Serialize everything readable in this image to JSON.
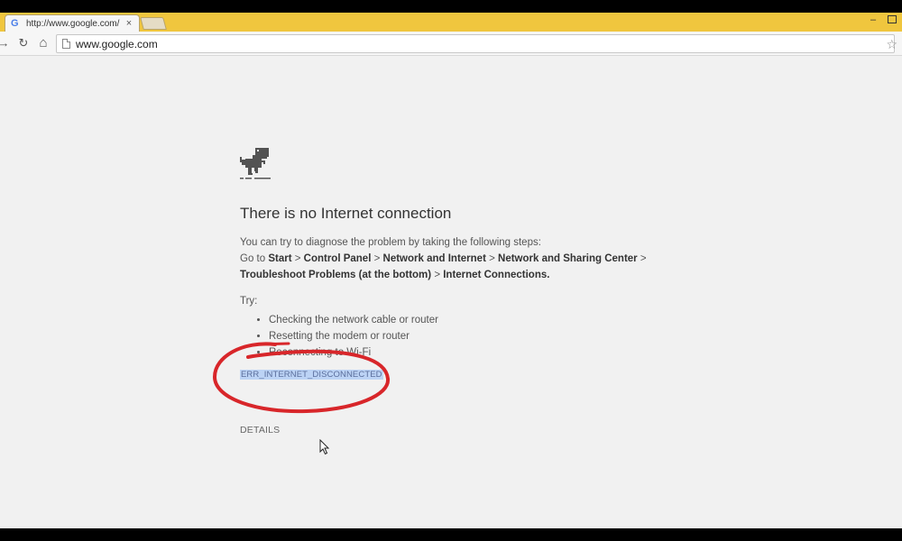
{
  "browser": {
    "tab": {
      "favicon": "G",
      "title": "http://www.google.com/",
      "close": "×"
    },
    "window_controls": {
      "minimize": "–"
    },
    "toolbar": {
      "back_icon": "→",
      "reload_icon": "↻",
      "home_icon": "⌂",
      "address": "www.google.com",
      "star_icon": "☆"
    },
    "colors": {
      "tabstrip": "#f0c63e",
      "highlight": "#bcd3f5",
      "annotation": "#d8262a"
    }
  },
  "error_page": {
    "icon": "dino-icon",
    "heading": "There is no Internet connection",
    "intro": "You can try to diagnose the problem by taking the following steps:",
    "steps_prefix": "Go to ",
    "steps": {
      "start": "Start",
      "sep": " > ",
      "control_panel": "Control Panel",
      "network_internet": "Network and Internet",
      "sharing_center": "Network and Sharing Center",
      "troubleshoot": "Troubleshoot Problems (at the bottom)",
      "internet_connections": "Internet Connections",
      "end": "."
    },
    "try_label": "Try:",
    "try_items": [
      "Checking the network cable or router",
      "Resetting the modem or router",
      "Reconnecting to Wi-Fi"
    ],
    "error_code": "ERR_INTERNET_DISCONNECTED",
    "details_label": "DETAILS"
  }
}
